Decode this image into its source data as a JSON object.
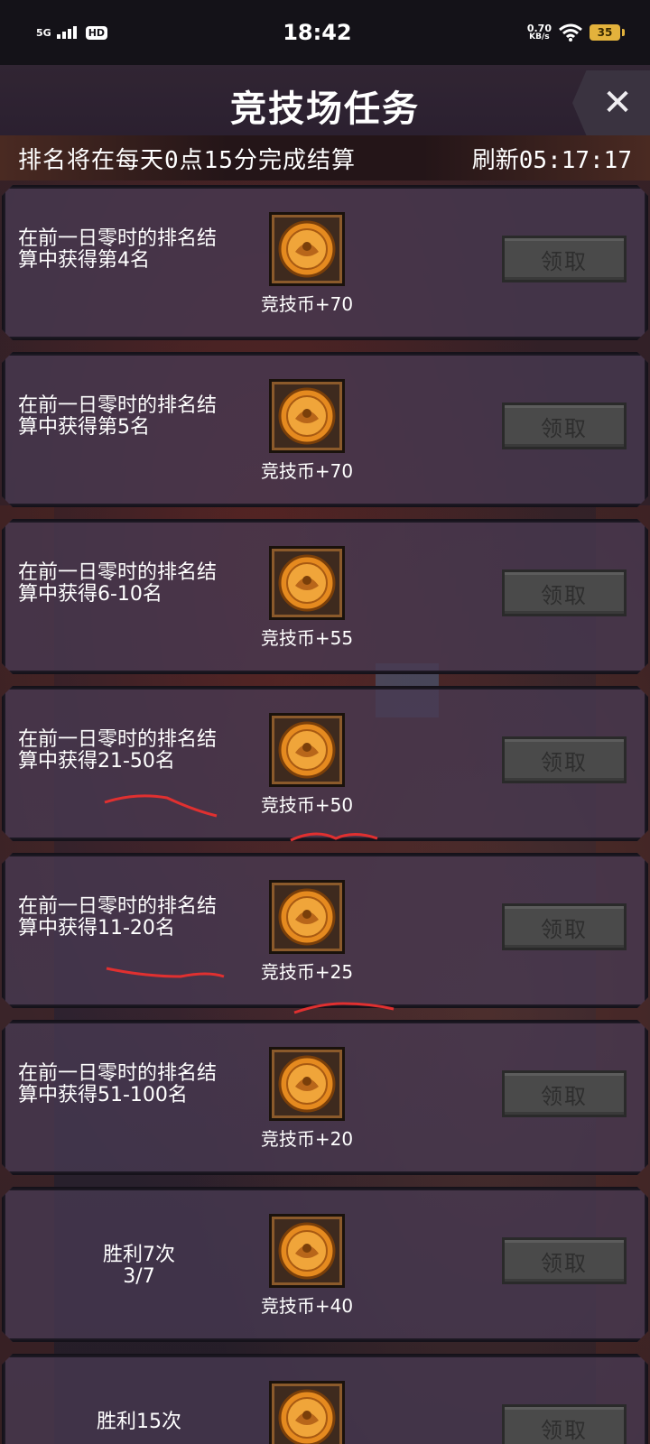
{
  "status_bar": {
    "network": "5G",
    "hd_badge": "HD",
    "time": "18:42",
    "net_speed_value": "0.70",
    "net_speed_unit": "KB/s",
    "battery": "35"
  },
  "header": {
    "title": "竞技场任务",
    "close_icon": "close-icon"
  },
  "notice": {
    "text": "排名将在每天0点15分完成结算",
    "refresh": "刷新05:17:17"
  },
  "tasks": [
    {
      "line1": "在前一日零时的排名结",
      "line2": "算中获得第4名",
      "reward": "竞技币+70",
      "button": "领取"
    },
    {
      "line1": "在前一日零时的排名结",
      "line2": "算中获得第5名",
      "reward": "竞技币+70",
      "button": "领取"
    },
    {
      "line1": "在前一日零时的排名结",
      "line2": "算中获得6-10名",
      "reward": "竞技币+55",
      "button": "领取"
    },
    {
      "line1": "在前一日零时的排名结",
      "line2": "算中获得21-50名",
      "reward": "竞技币+50",
      "button": "领取"
    },
    {
      "line1": "在前一日零时的排名结",
      "line2": "算中获得11-20名",
      "reward": "竞技币+25",
      "button": "领取"
    },
    {
      "line1": "在前一日零时的排名结",
      "line2": "算中获得51-100名",
      "reward": "竞技币+20",
      "button": "领取"
    },
    {
      "line1": "胜利7次",
      "line2": "3/7",
      "reward": "竞技币+40",
      "button": "领取"
    },
    {
      "line1": "胜利15次",
      "line2": "",
      "reward": "",
      "button": "领取"
    }
  ],
  "colors": {
    "button_disabled": "#4a4a4a",
    "card_bg": "#483a52",
    "annotation_red": "#e03030"
  }
}
